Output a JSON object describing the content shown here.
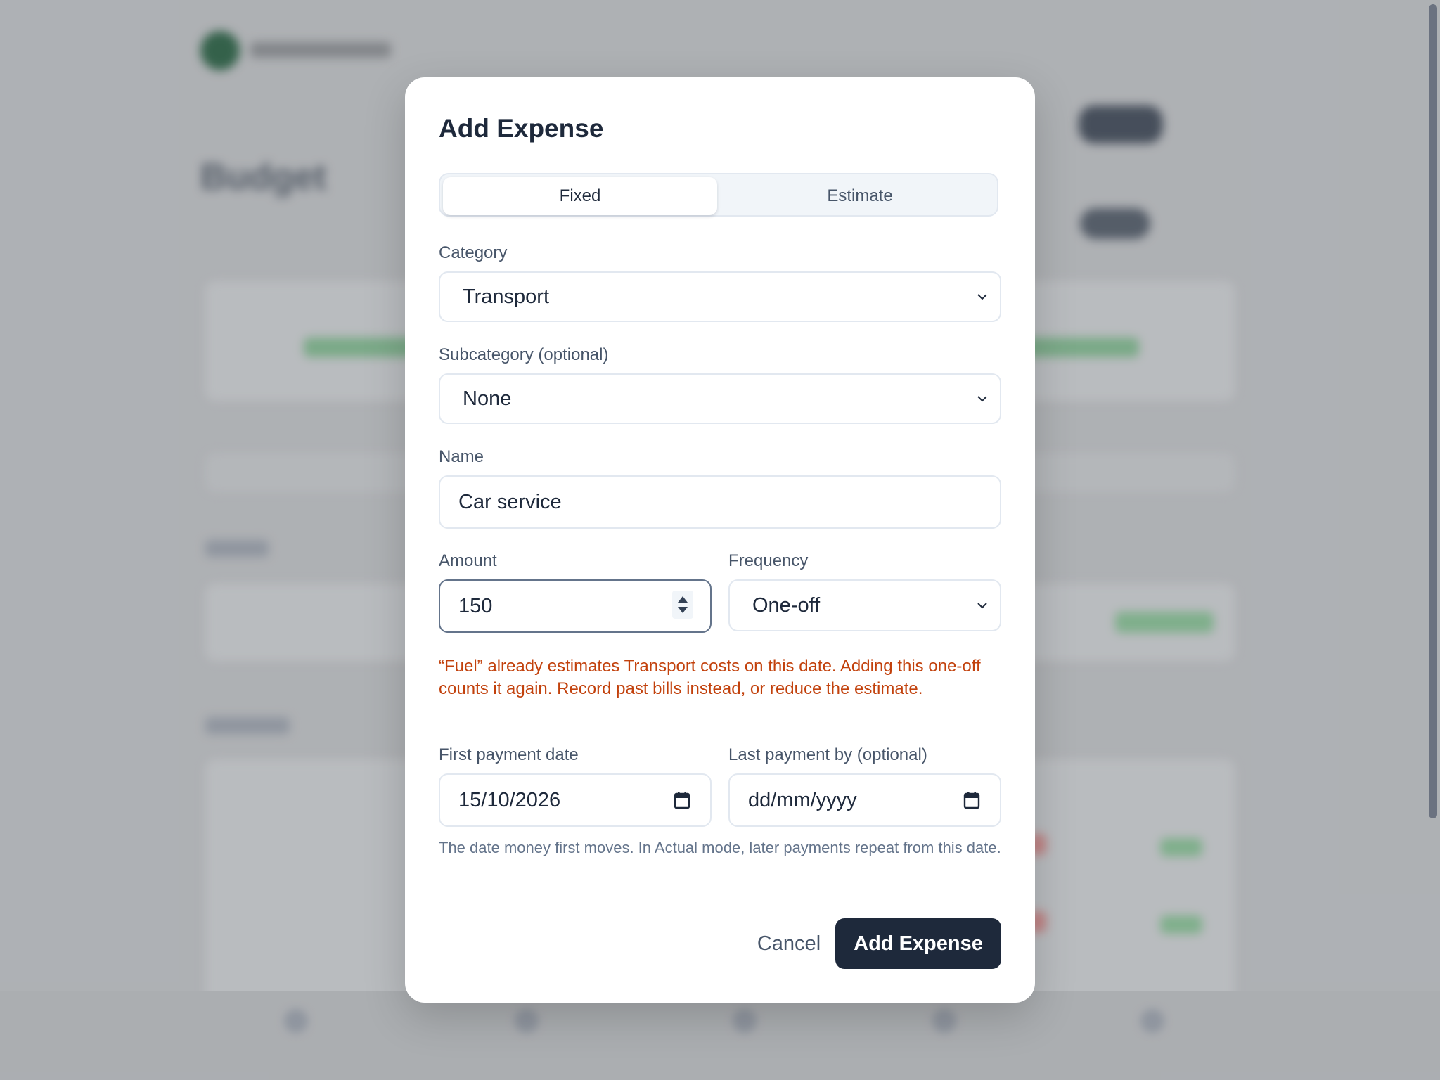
{
  "modal": {
    "title": "Add Expense",
    "tabs": [
      {
        "label": "Fixed",
        "active": true
      },
      {
        "label": "Estimate",
        "active": false
      }
    ],
    "category": {
      "label": "Category",
      "value": "Transport"
    },
    "subcategory": {
      "label": "Subcategory (optional)",
      "value": "None"
    },
    "name": {
      "label": "Name",
      "value": "Car service"
    },
    "amount": {
      "label": "Amount",
      "value": "150"
    },
    "frequency": {
      "label": "Frequency",
      "value": "One-off"
    },
    "warning": "“Fuel” already estimates Transport costs on this date. Adding this one-off counts it again. Record past bills instead, or reduce the estimate.",
    "first_payment": {
      "label": "First payment date",
      "value": "15/10/2026"
    },
    "last_payment": {
      "label": "Last payment by (optional)",
      "placeholder": "dd/mm/yyyy"
    },
    "helper": "The date money first moves. In Actual mode, later payments repeat from this date.",
    "cancel_label": "Cancel",
    "submit_label": "Add Expense"
  },
  "background": {
    "page_title": "Budget"
  },
  "colors": {
    "primary": "#1e293b",
    "warning": "#c2410c",
    "muted": "#475569",
    "border": "#e2e8f0"
  },
  "icons": {
    "select": "chevron-down-icon",
    "date": "calendar-icon"
  }
}
